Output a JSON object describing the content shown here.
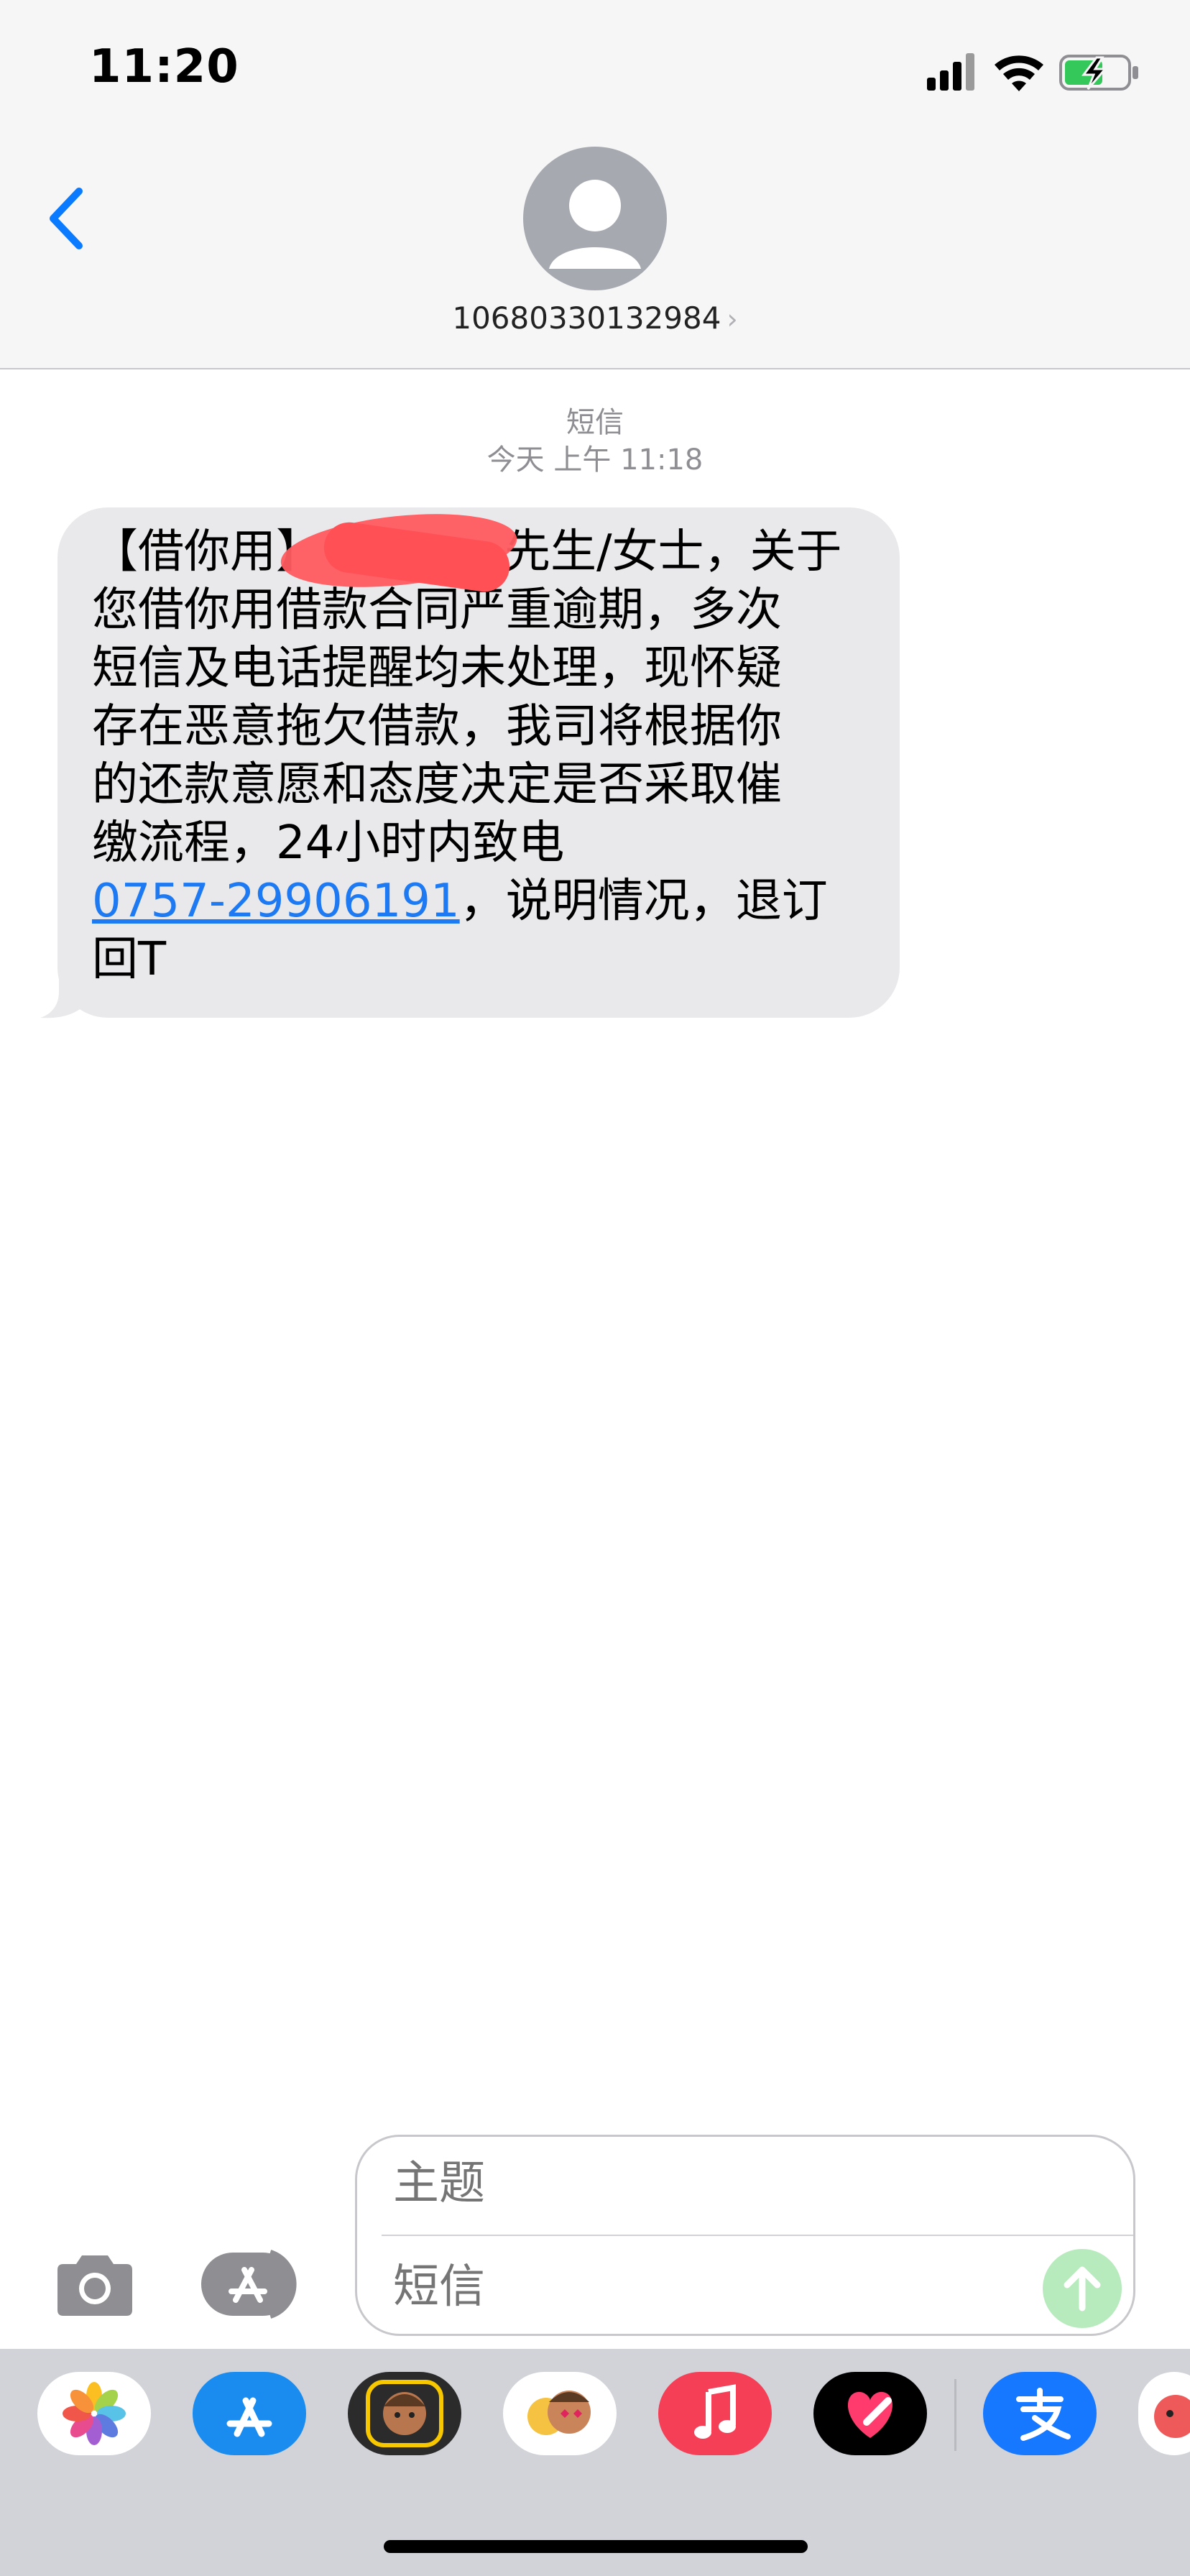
{
  "status_bar": {
    "time": "11:20"
  },
  "header": {
    "contact": "10680330132984",
    "chevron": "›"
  },
  "thread": {
    "service": "短信",
    "timestamp": "今天 上午 11:18",
    "message": {
      "line1": "【借你用】",
      "line1b": "先生/女士，关于",
      "line2": "您借你用借款合同严重逾期，多次",
      "line3": "短信及电话提醒均未处理，现怀疑",
      "line4": "存在恶意拖欠借款，我司将根据你",
      "line5": "的还款意愿和态度决定是否采取催",
      "line6": "缴流程，24小时内致电",
      "phone": "0757-29906191",
      "line7_tail": "，说明情况，退订",
      "line8": "回T"
    }
  },
  "compose": {
    "subject_placeholder": "主题",
    "message_placeholder": "短信"
  },
  "drawer": {
    "apps": [
      "photos",
      "app-store",
      "memoji",
      "animoji",
      "music",
      "digital-touch",
      "alipay",
      "other-app"
    ]
  },
  "colors": {
    "link": "#1d7af3",
    "ios_blue": "#0a7aff",
    "bubble": "#e9e9eb",
    "send": "#b7ebbd"
  }
}
